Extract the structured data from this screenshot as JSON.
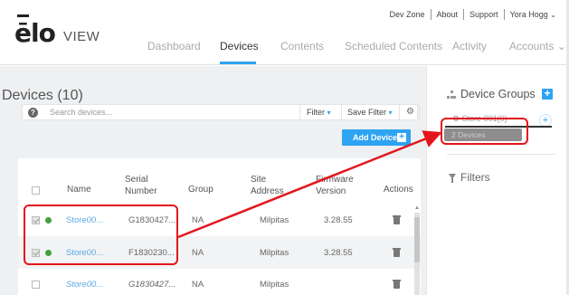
{
  "header": {
    "logo_brand": "ēlo",
    "logo_product": "VIEW",
    "utility": {
      "dev_zone": "Dev Zone",
      "about": "About",
      "support": "Support",
      "user": "Yora Hogg"
    },
    "nav": [
      "Dashboard",
      "Devices",
      "Contents",
      "Scheduled Contents",
      "Activity",
      "Accounts"
    ],
    "active_nav": "Devices",
    "accent_color": "#2ea3f2"
  },
  "devices": {
    "title": "Devices (10)",
    "search_placeholder": "Search devices...",
    "filter_label": "Filter",
    "save_filter_label": "Save Filter",
    "add_device_label": "Add Device",
    "columns": [
      "Name",
      "Serial Number",
      "Group",
      "Site Address",
      "Firmware Version",
      "Actions"
    ],
    "rows": [
      {
        "name": "Store00...",
        "serial": "G1830427...",
        "group": "NA",
        "site": "Milpitas",
        "firmware": "3.28.55",
        "checked": true,
        "status": "online"
      },
      {
        "name": "Store00...",
        "serial": "F1830230...",
        "group": "NA",
        "site": "Milpitas",
        "firmware": "3.28.55",
        "checked": true,
        "status": "online"
      },
      {
        "name": "Store00...",
        "serial": "G1830427...",
        "group": "NA",
        "site": "Milpitas",
        "firmware": "",
        "checked": false,
        "status": "none"
      }
    ],
    "status_color": "#3fa03f"
  },
  "device_groups": {
    "title": "Device Groups",
    "store_label": "Store 001(0)",
    "devices_chip": "2 Devices",
    "filters_title": "Filters"
  },
  "annotation_color": "#e3161c"
}
